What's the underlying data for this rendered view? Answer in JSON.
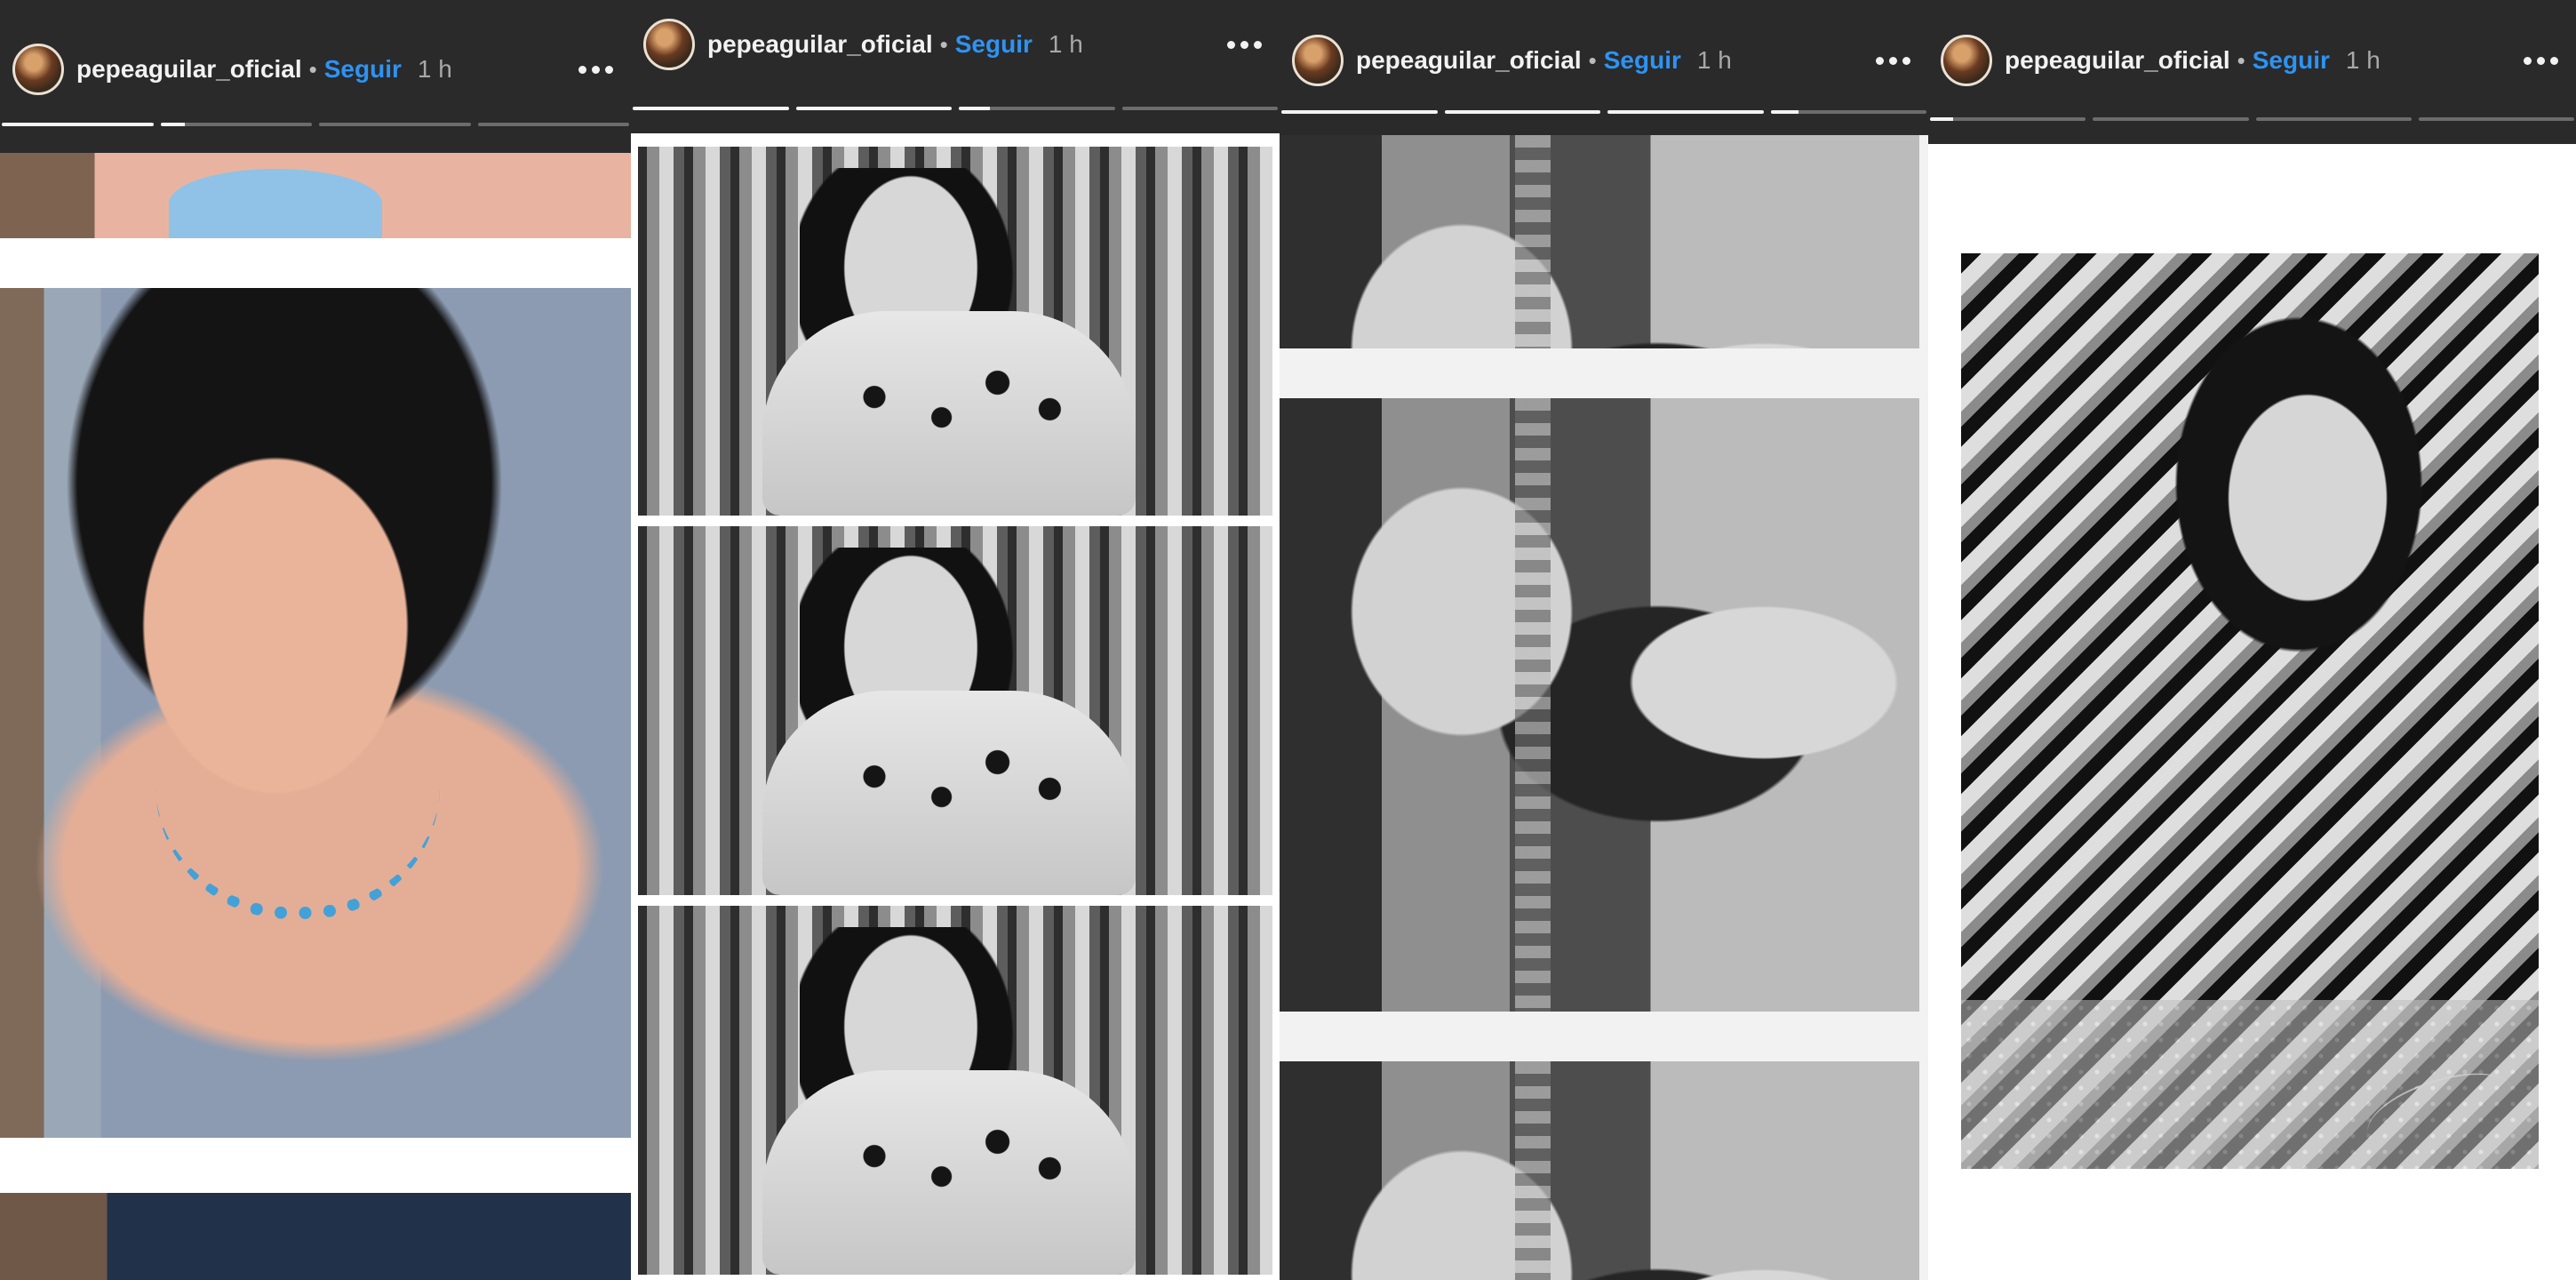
{
  "stories": [
    {
      "username": "pepeaguilar_oficial",
      "follow_label": "Seguir",
      "time": "1 h",
      "progress": [
        1,
        0.16,
        0,
        0
      ]
    },
    {
      "username": "pepeaguilar_oficial",
      "follow_label": "Seguir",
      "time": "1 h",
      "progress": [
        1,
        1,
        0.2,
        0
      ]
    },
    {
      "username": "pepeaguilar_oficial",
      "follow_label": "Seguir",
      "time": "1 h",
      "progress": [
        1,
        1,
        1,
        0.18
      ]
    },
    {
      "username": "pepeaguilar_oficial",
      "follow_label": "Seguir",
      "time": "1 h",
      "progress": [
        0.15,
        0,
        0,
        0
      ]
    }
  ],
  "icons": {
    "more": "more-options-icon",
    "avatar": "profile-avatar"
  },
  "colors": {
    "background": "#2b2b2b",
    "follow": "#2d93f3",
    "text": "#f2f2f2",
    "muted": "#a8a8a8"
  }
}
